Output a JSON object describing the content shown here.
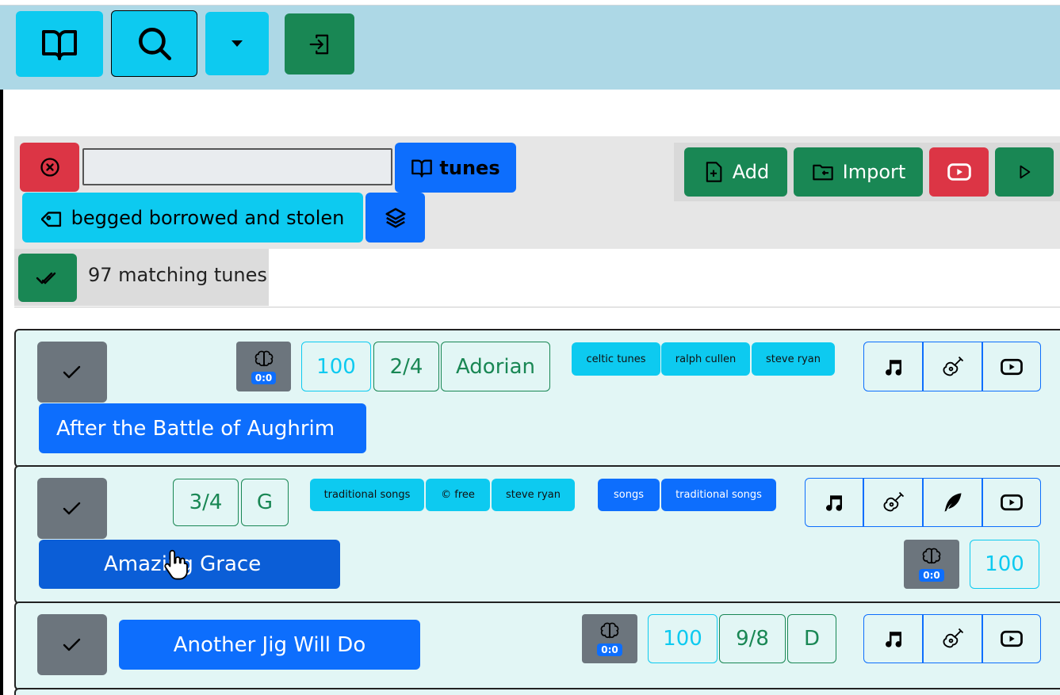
{
  "navbar": {
    "buttons": [
      {
        "name": "tunes-book-button",
        "icon": "book-icon"
      },
      {
        "name": "search-button",
        "icon": "search-icon"
      },
      {
        "name": "dropdown-button",
        "icon": "caret-down-icon"
      },
      {
        "name": "login-button",
        "icon": "login-icon"
      }
    ]
  },
  "filter": {
    "clear_icon": "x-circle-icon",
    "search_value": "",
    "collection_label": "tunes",
    "book_label": "begged borrowed and stolen",
    "add_label": "Add",
    "import_label": "Import"
  },
  "results": {
    "count_text": "97 matching tunes"
  },
  "tunes": [
    {
      "title": "After the Battle of Aughrim",
      "brain": "0:0",
      "tempo": "100",
      "meter": "2/4",
      "key": "Adorian",
      "tags": [
        "celtic tunes",
        "ralph cullen",
        "steve ryan"
      ],
      "actions": [
        "music-note-icon",
        "guitar-icon",
        "youtube-icon"
      ]
    },
    {
      "title": "Amazing Grace",
      "brain": "0:0",
      "tempo": "100",
      "meter": "3/4",
      "key": "G",
      "tags": [
        "traditional songs",
        "© free",
        "steve ryan"
      ],
      "books": [
        "songs",
        "traditional songs"
      ],
      "actions": [
        "music-note-icon",
        "guitar-icon",
        "quill-icon",
        "youtube-icon"
      ]
    },
    {
      "title": "Another Jig Will Do",
      "brain": "0:0",
      "tempo": "100",
      "meter": "9/8",
      "key": "D",
      "actions": [
        "music-note-icon",
        "guitar-icon",
        "youtube-icon"
      ]
    }
  ],
  "colors": {
    "navbar_bg": "#add8e6",
    "primary": "#0d6efd",
    "info": "#0dcaf0",
    "success": "#198754",
    "danger": "#dc3545",
    "secondary": "#6c757d",
    "row_bg": "#e2f6f5"
  }
}
